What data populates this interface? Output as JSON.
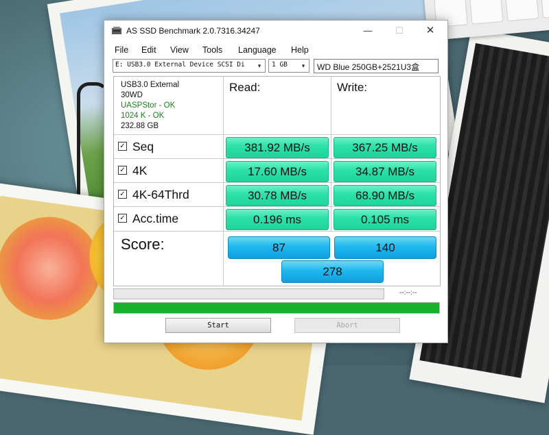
{
  "window": {
    "title": "AS SSD Benchmark 2.0.7316.34247",
    "minimize_glyph": "—",
    "maximize_glyph": "☐",
    "close_glyph": "✕"
  },
  "menu": [
    "File",
    "Edit",
    "View",
    "Tools",
    "Language",
    "Help"
  ],
  "toolbar": {
    "drive": "E: USB3.0 External Device SCSI Di",
    "size": "1 GB",
    "drive_name": "WD Blue 250GB+2521U3盒"
  },
  "info": {
    "line1": "USB3.0 External",
    "line2": "30WD",
    "line3": "UASPStor - OK",
    "line4": "1024 K - OK",
    "line5": "232.88 GB"
  },
  "headers": {
    "read": "Read:",
    "write": "Write:"
  },
  "rows": [
    {
      "label": "Seq",
      "read": "381.92 MB/s",
      "write": "367.25 MB/s"
    },
    {
      "label": "4K",
      "read": "17.60 MB/s",
      "write": "34.87 MB/s"
    },
    {
      "label": "4K-64Thrd",
      "read": "30.78 MB/s",
      "write": "68.90 MB/s"
    },
    {
      "label": "Acc.time",
      "read": "0.196 ms",
      "write": "0.105 ms"
    }
  ],
  "score": {
    "label": "Score:",
    "read": "87",
    "write": "140",
    "total": "278"
  },
  "progress": {
    "time": "--:--:--",
    "main_fraction": 1.0
  },
  "buttons": {
    "start": "Start",
    "abort": "Abort"
  },
  "colors": {
    "result_green": "#2ee2a9",
    "score_blue": "#1fb8ee",
    "progress_green": "#19b02c",
    "status_ok": "#1a7f1a"
  },
  "icons": {
    "checkbox": "checkmark-icon",
    "dropdown": "chevron-down-icon",
    "app": "app-icon"
  }
}
